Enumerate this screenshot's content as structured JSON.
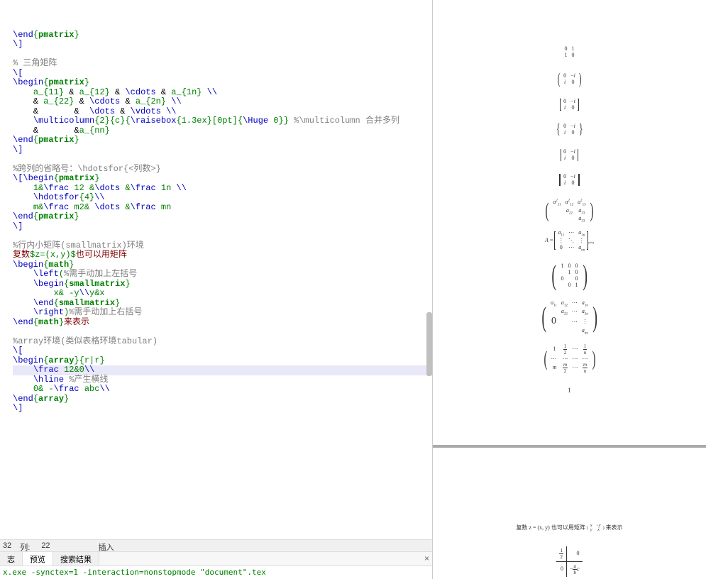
{
  "editor": {
    "lines": [
      {
        "type": "end",
        "env": "pmatrix"
      },
      {
        "type": "cmd",
        "text": "\\]"
      },
      {
        "type": "blank"
      },
      {
        "type": "comment",
        "text": "% 三角矩阵"
      },
      {
        "type": "cmd",
        "text": "\\["
      },
      {
        "type": "begin",
        "env": "pmatrix"
      },
      {
        "type": "code",
        "indent": 4,
        "parts": [
          {
            "t": "str",
            "v": "a_{11}"
          },
          {
            "t": "op",
            "v": " & "
          },
          {
            "t": "str",
            "v": "a_{12}"
          },
          {
            "t": "op",
            "v": " & "
          },
          {
            "t": "cmd",
            "v": "\\cdots"
          },
          {
            "t": "op",
            "v": " & "
          },
          {
            "t": "str",
            "v": "a_{1n}"
          },
          {
            "t": "op",
            "v": " "
          },
          {
            "t": "cmd",
            "v": "\\\\"
          }
        ]
      },
      {
        "type": "code",
        "indent": 4,
        "parts": [
          {
            "t": "op",
            "v": "& "
          },
          {
            "t": "str",
            "v": "a_{22}"
          },
          {
            "t": "op",
            "v": " & "
          },
          {
            "t": "cmd",
            "v": "\\cdots"
          },
          {
            "t": "op",
            "v": " & "
          },
          {
            "t": "str",
            "v": "a_{2n}"
          },
          {
            "t": "op",
            "v": " "
          },
          {
            "t": "cmd",
            "v": "\\\\"
          }
        ]
      },
      {
        "type": "code",
        "indent": 4,
        "parts": [
          {
            "t": "op",
            "v": "&       &  "
          },
          {
            "t": "cmd",
            "v": "\\dots"
          },
          {
            "t": "op",
            "v": " & "
          },
          {
            "t": "cmd",
            "v": "\\vdots"
          },
          {
            "t": "op",
            "v": " "
          },
          {
            "t": "cmd",
            "v": "\\\\"
          }
        ]
      },
      {
        "type": "code",
        "indent": 4,
        "parts": [
          {
            "t": "cmd",
            "v": "\\multicolumn"
          },
          {
            "t": "str",
            "v": "{2}{c}{"
          },
          {
            "t": "cmd",
            "v": "\\raisebox"
          },
          {
            "t": "str",
            "v": "{1.3ex}[0pt]{"
          },
          {
            "t": "cmd",
            "v": "\\Huge"
          },
          {
            "t": "str",
            "v": " 0}}"
          },
          {
            "t": "op",
            "v": " "
          },
          {
            "t": "comment",
            "v": "%\\multicolumn 合并多列"
          }
        ]
      },
      {
        "type": "code",
        "indent": 4,
        "parts": [
          {
            "t": "op",
            "v": "&       &"
          },
          {
            "t": "str",
            "v": "a_{nn}"
          }
        ]
      },
      {
        "type": "end",
        "env": "pmatrix"
      },
      {
        "type": "cmd",
        "text": "\\]"
      },
      {
        "type": "blank"
      },
      {
        "type": "comment",
        "text": "%跨列的省略号：\\hdotsfor{<列数>}"
      },
      {
        "type": "code",
        "indent": 0,
        "parts": [
          {
            "t": "cmd",
            "v": "\\["
          },
          {
            "t": "cmd",
            "v": "\\begin"
          },
          {
            "t": "str",
            "v": "{"
          },
          {
            "t": "env",
            "v": "pmatrix"
          },
          {
            "t": "str",
            "v": "}"
          }
        ]
      },
      {
        "type": "code",
        "indent": 4,
        "parts": [
          {
            "t": "str",
            "v": "1&"
          },
          {
            "t": "cmd",
            "v": "\\frac"
          },
          {
            "t": "str",
            "v": " 12 &"
          },
          {
            "t": "cmd",
            "v": "\\dots"
          },
          {
            "t": "str",
            "v": " &"
          },
          {
            "t": "cmd",
            "v": "\\frac"
          },
          {
            "t": "str",
            "v": " 1n "
          },
          {
            "t": "cmd",
            "v": "\\\\"
          }
        ]
      },
      {
        "type": "code",
        "indent": 4,
        "parts": [
          {
            "t": "cmd",
            "v": "\\hdotsfor"
          },
          {
            "t": "str",
            "v": "{4}"
          },
          {
            "t": "cmd",
            "v": "\\\\"
          }
        ]
      },
      {
        "type": "code",
        "indent": 4,
        "parts": [
          {
            "t": "str",
            "v": "m&"
          },
          {
            "t": "cmd",
            "v": "\\frac"
          },
          {
            "t": "str",
            "v": " m2& "
          },
          {
            "t": "cmd",
            "v": "\\dots"
          },
          {
            "t": "str",
            "v": " &"
          },
          {
            "t": "cmd",
            "v": "\\frac"
          },
          {
            "t": "str",
            "v": " mn"
          }
        ]
      },
      {
        "type": "end",
        "env": "pmatrix"
      },
      {
        "type": "cmd",
        "text": "\\]"
      },
      {
        "type": "blank"
      },
      {
        "type": "comment",
        "text": "%行内小矩阵(smallmatrix)环境"
      },
      {
        "type": "code",
        "indent": 0,
        "parts": [
          {
            "t": "cn",
            "v": "复数"
          },
          {
            "t": "str",
            "v": "$z=(x,y)$"
          },
          {
            "t": "cn",
            "v": "也可以用矩阵"
          }
        ]
      },
      {
        "type": "begin",
        "env": "math"
      },
      {
        "type": "code",
        "indent": 4,
        "parts": [
          {
            "t": "cmd",
            "v": "\\left"
          },
          {
            "t": "str",
            "v": "("
          },
          {
            "t": "comment",
            "v": "%需手动加上左括号"
          }
        ]
      },
      {
        "type": "code",
        "indent": 4,
        "parts": [
          {
            "t": "cmd",
            "v": "\\begin"
          },
          {
            "t": "str",
            "v": "{"
          },
          {
            "t": "env",
            "v": "smallmatrix"
          },
          {
            "t": "str",
            "v": "}"
          }
        ]
      },
      {
        "type": "code",
        "indent": 8,
        "parts": [
          {
            "t": "str",
            "v": "x& -y"
          },
          {
            "t": "cmd",
            "v": "\\\\"
          },
          {
            "t": "str",
            "v": "y&x"
          }
        ]
      },
      {
        "type": "code",
        "indent": 4,
        "parts": [
          {
            "t": "cmd",
            "v": "\\end"
          },
          {
            "t": "str",
            "v": "{"
          },
          {
            "t": "env",
            "v": "smallmatrix"
          },
          {
            "t": "str",
            "v": "}"
          }
        ]
      },
      {
        "type": "code",
        "indent": 4,
        "parts": [
          {
            "t": "cmd",
            "v": "\\right"
          },
          {
            "t": "str",
            "v": ")"
          },
          {
            "t": "comment",
            "v": "%需手动加上右括号"
          }
        ]
      },
      {
        "type": "code",
        "indent": 0,
        "parts": [
          {
            "t": "cmd",
            "v": "\\end"
          },
          {
            "t": "str",
            "v": "{"
          },
          {
            "t": "env",
            "v": "math"
          },
          {
            "t": "str",
            "v": "}"
          },
          {
            "t": "cn",
            "v": "来表示"
          }
        ]
      },
      {
        "type": "blank"
      },
      {
        "type": "comment",
        "text": "%array环境(类似表格环境tabular)"
      },
      {
        "type": "cmd",
        "text": "\\["
      },
      {
        "type": "code",
        "indent": 0,
        "parts": [
          {
            "t": "cmd",
            "v": "\\begin"
          },
          {
            "t": "str",
            "v": "{"
          },
          {
            "t": "env",
            "v": "array"
          },
          {
            "t": "str",
            "v": "}{r|r}"
          }
        ]
      },
      {
        "type": "code",
        "indent": 4,
        "hl": true,
        "parts": [
          {
            "t": "cmd",
            "v": "\\frac"
          },
          {
            "t": "str",
            "v": " 12&0"
          },
          {
            "t": "cmd",
            "v": "\\\\"
          }
        ]
      },
      {
        "type": "code",
        "indent": 4,
        "parts": [
          {
            "t": "cmd",
            "v": "\\hline"
          },
          {
            "t": "op",
            "v": " "
          },
          {
            "t": "comment",
            "v": "%产生横线"
          }
        ]
      },
      {
        "type": "code",
        "indent": 4,
        "parts": [
          {
            "t": "str",
            "v": "0& -"
          },
          {
            "t": "cmd",
            "v": "\\frac"
          },
          {
            "t": "str",
            "v": " abc"
          },
          {
            "t": "cmd",
            "v": "\\\\"
          }
        ]
      },
      {
        "type": "end",
        "env": "array"
      },
      {
        "type": "cmd",
        "text": "\\]"
      }
    ]
  },
  "status": {
    "line_label": "32",
    "col_label": "列:",
    "col_val": "22",
    "mode": "插入"
  },
  "tabs": {
    "items": [
      "志",
      "预览",
      "搜索结果"
    ],
    "close": "×"
  },
  "log": "x.exe -synctex=1 -interaction=nonstopmode \"document\".tex",
  "preview": {
    "text_line": "复数 z = (x, y) 也可以用矩阵 ",
    "text_line_after": " 来表示",
    "smallmat": {
      "r1": [
        "x",
        "−y"
      ],
      "r2": [
        "y",
        "x"
      ],
      "inline_r1": [
        "x",
        "−y"
      ],
      "inline_r2": [
        "y",
        "x"
      ]
    }
  },
  "chart_data": {
    "type": "table",
    "matrices": [
      {
        "delim": "none",
        "rows": [
          [
            "0",
            "1"
          ],
          [
            "1",
            "0"
          ]
        ]
      },
      {
        "delim": "paren",
        "rows": [
          [
            "0",
            "−i"
          ],
          [
            "i",
            "0"
          ]
        ]
      },
      {
        "delim": "bracket",
        "rows": [
          [
            "0",
            "−i"
          ],
          [
            "i",
            "0"
          ]
        ]
      },
      {
        "delim": "brace",
        "rows": [
          [
            "0",
            "−i"
          ],
          [
            "i",
            "0"
          ]
        ]
      },
      {
        "delim": "vbar",
        "rows": [
          [
            "0",
            "−i"
          ],
          [
            "i",
            "0"
          ]
        ]
      },
      {
        "delim": "dvbar",
        "rows": [
          [
            "0",
            "−i"
          ],
          [
            "i",
            "0"
          ]
        ]
      },
      {
        "delim": "paren",
        "rows": [
          [
            "a²₁₁",
            "a²₁₂",
            "a²₁₃"
          ],
          [
            "",
            "a₂₂",
            "a₂₃"
          ],
          [
            "",
            "",
            "a₃₃"
          ]
        ]
      },
      {
        "delim": "bracket",
        "label": "A =",
        "rows": [
          [
            "a₁₁",
            "⋯",
            "a₁ₙ"
          ],
          [
            "⋮",
            "⋱",
            "⋮"
          ],
          [
            "0",
            "⋯",
            "aₙₙ"
          ]
        ],
        "sub": "n×n"
      },
      {
        "delim": "paren",
        "rows": [
          [
            "1",
            "0",
            "0"
          ],
          [
            "",
            "1",
            "0"
          ],
          [
            "0",
            "",
            "0"
          ],
          [
            "",
            "0",
            "1"
          ]
        ]
      },
      {
        "delim": "paren",
        "rows": [
          [
            "a₁₁",
            "a₁₂",
            "⋯",
            "a₁ₙ"
          ],
          [
            "",
            "a₂₂",
            "⋯",
            "a₂ₙ"
          ],
          [
            "0",
            "",
            "⋯",
            "⋮"
          ],
          [
            "",
            "",
            "",
            "aₙₙ"
          ]
        ]
      },
      {
        "delim": "paren",
        "rows": [
          [
            "1",
            "1/2",
            "⋯",
            "1/n"
          ],
          [
            "⋯",
            "⋯",
            "⋯",
            "⋯"
          ],
          [
            "m",
            "m/2",
            "⋯",
            "m/n"
          ]
        ]
      }
    ],
    "output_1": "1",
    "array": {
      "r1": [
        "1/2",
        "0"
      ],
      "r2": [
        "0",
        "−(a/b)c"
      ]
    }
  }
}
